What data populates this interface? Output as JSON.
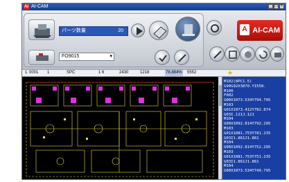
{
  "window": {
    "title": "AI-CAM",
    "app_icon": "AI",
    "minimize": "_",
    "maximize": "□",
    "close": "×"
  },
  "toolbar": {
    "part_label": "パーツ数量",
    "part_value": "20",
    "program_select": "FO9015",
    "logo_text": "AI-CAM"
  },
  "status": {
    "f1": "1",
    "f2": "0001",
    "f3": "1",
    "f4": "SPC",
    "f5": "1 6",
    "f6": "2430",
    "f7": "1218",
    "f8": "78.884%",
    "f9": "5552"
  },
  "nc_lines": [
    "M102(8PC1.5)",
    "G90G92X3870.Y1558.",
    "M100",
    "F002",
    "G00X1073.534Y794.795",
    "M103",
    "G01X1073.412Y782.874",
    "G03I.121J.121",
    "M104",
    "G00X1092.814Y792.295",
    "M103",
    "G01X1081.753Y781.235",
    "G03I1.861J1.861",
    "M104",
    "G00X1092.814Y752.295",
    "M103",
    "G01X1081.753Y751.235",
    "G03I1.861J1.861",
    "M104",
    "G00X1073.534Y749.795"
  ],
  "colors": {
    "accent": "#2a58b8",
    "nc_bg": "#1a3fa2",
    "logo": "#d51b12",
    "cad_yellow": "#e8e030",
    "cad_pink": "#e030e0"
  }
}
